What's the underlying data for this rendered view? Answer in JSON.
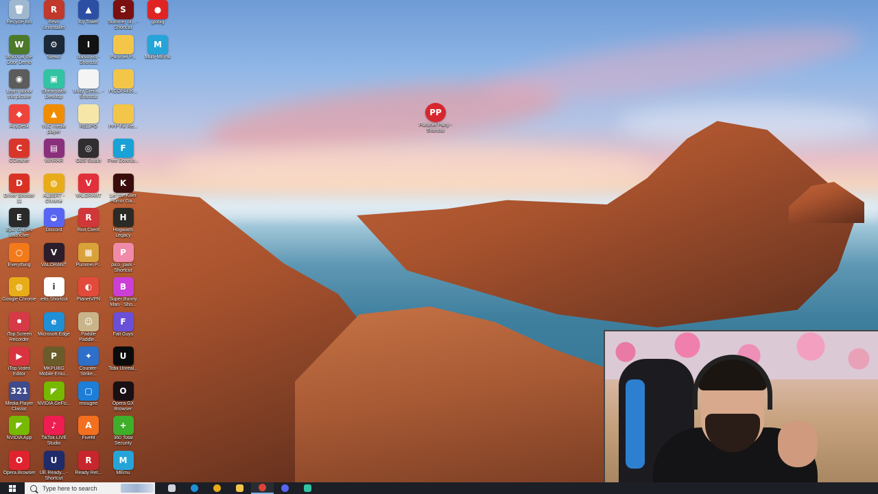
{
  "desktop": {
    "icons": [
      {
        "label": "Recycle Bin",
        "icon": "recycle-bin-icon",
        "color": "#9fb7cf",
        "glyph": "🗑",
        "col": 0,
        "row": 0
      },
      {
        "label": "Revo Uninstaller",
        "icon": "revo-uninstaller-icon",
        "color": "#c0392b",
        "glyph": "R",
        "col": 1,
        "row": 0
      },
      {
        "label": "Icy Tower",
        "icon": "icy-tower-icon",
        "color": "#2c4fa3",
        "glyph": "▲",
        "col": 2,
        "row": 0
      },
      {
        "label": "Summer of... - Shortcut",
        "icon": "summer-game-icon",
        "color": "#7a1010",
        "glyph": "S",
        "col": 3,
        "row": 0
      },
      {
        "label": "globig",
        "icon": "globig-icon",
        "color": "#e02424",
        "glyph": "●",
        "col": 4,
        "row": 0
      },
      {
        "label": "Who's at the Door Demo",
        "icon": "door-demo-icon",
        "color": "#4c7a2a",
        "glyph": "W",
        "col": 0,
        "row": 1
      },
      {
        "label": "Steam",
        "icon": "steam-icon",
        "color": "#1b2838",
        "glyph": "⚙",
        "col": 1,
        "row": 1
      },
      {
        "label": "Illusionist - Shortcut",
        "icon": "illusionist-icon",
        "color": "#121212",
        "glyph": "I",
        "col": 2,
        "row": 1
      },
      {
        "label": "Pummel P...",
        "icon": "folder-icon",
        "color": "#f3c64a",
        "glyph": "",
        "col": 3,
        "row": 1
      },
      {
        "label": "Multi-MEmu",
        "icon": "multi-memu-icon",
        "color": "#25a4d8",
        "glyph": "M",
        "col": 4,
        "row": 1
      },
      {
        "label": "Learn about this picture",
        "icon": "learn-picture-icon",
        "color": "#5c5c5c",
        "glyph": "◉",
        "col": 0,
        "row": 2
      },
      {
        "label": "Streamlabs Desktop",
        "icon": "streamlabs-icon",
        "color": "#31c3a2",
        "glyph": "▣",
        "col": 1,
        "row": 2
      },
      {
        "label": "Unity Grein... - Shortcut",
        "icon": "document-icon",
        "color": "#f4f4f4",
        "glyph": "",
        "col": 2,
        "row": 2
      },
      {
        "label": "PICOPARK...",
        "icon": "folder-icon",
        "color": "#f3c64a",
        "glyph": "",
        "col": 3,
        "row": 2
      },
      {
        "label": "AnyDesk",
        "icon": "anydesk-icon",
        "color": "#ef443b",
        "glyph": "◆",
        "col": 0,
        "row": 3
      },
      {
        "label": "VLC media player",
        "icon": "vlc-icon",
        "color": "#f08c00",
        "glyph": "▲",
        "col": 1,
        "row": 3
      },
      {
        "label": "RELIPO",
        "icon": "document-icon",
        "color": "#f6e7a8",
        "glyph": "",
        "col": 2,
        "row": 3
      },
      {
        "label": "PPP Fix Re...",
        "icon": "folder-icon",
        "color": "#f3c64a",
        "glyph": "",
        "col": 3,
        "row": 3
      },
      {
        "label": "CCleaner",
        "icon": "ccleaner-icon",
        "color": "#d9362b",
        "glyph": "C",
        "col": 0,
        "row": 4
      },
      {
        "label": "WinRAR",
        "icon": "winrar-icon",
        "color": "#8a2f7c",
        "glyph": "▤",
        "col": 1,
        "row": 4
      },
      {
        "label": "OBS Studio",
        "icon": "obs-icon",
        "color": "#302e31",
        "glyph": "◎",
        "col": 2,
        "row": 4
      },
      {
        "label": "Free Downlo...",
        "icon": "free-download-icon",
        "color": "#1aa1d6",
        "glyph": "F",
        "col": 3,
        "row": 4
      },
      {
        "label": "Driver Booster 11",
        "icon": "driver-booster-icon",
        "color": "#d93224",
        "glyph": "D",
        "col": 0,
        "row": 5
      },
      {
        "label": "ALBERT - Chrome",
        "icon": "chrome-icon",
        "color": "#e8ac18",
        "glyph": "◍",
        "col": 1,
        "row": 5
      },
      {
        "label": "VALORANT",
        "icon": "valorant-icon",
        "color": "#e1303b",
        "glyph": "V",
        "col": 2,
        "row": 5
      },
      {
        "label": "Let the Killer Horror Ga...",
        "icon": "killer-horror-icon",
        "color": "#3a0d0d",
        "glyph": "K",
        "col": 3,
        "row": 5
      },
      {
        "label": "Epic Games Launcher",
        "icon": "epic-games-icon",
        "color": "#2a2a2a",
        "glyph": "E",
        "col": 0,
        "row": 6
      },
      {
        "label": "Discord",
        "icon": "discord-icon",
        "color": "#5865f2",
        "glyph": "◒",
        "col": 1,
        "row": 6
      },
      {
        "label": "Riot Client",
        "icon": "riot-client-icon",
        "color": "#d13639",
        "glyph": "R",
        "col": 2,
        "row": 6
      },
      {
        "label": "Hogwarts Legacy",
        "icon": "hogwarts-icon",
        "color": "#2c2a25",
        "glyph": "H",
        "col": 3,
        "row": 6
      },
      {
        "label": "Everything",
        "icon": "everything-search-icon",
        "color": "#f27a1a",
        "glyph": "○",
        "col": 0,
        "row": 7
      },
      {
        "label": "VALORANT",
        "icon": "valorant-icon",
        "color": "#2b1d2b",
        "glyph": "V",
        "col": 1,
        "row": 7
      },
      {
        "label": "Pummel P...",
        "icon": "pummel-party-icon",
        "color": "#d8a13a",
        "glyph": "▦",
        "col": 2,
        "row": 7
      },
      {
        "label": "pico_park - Shortcut",
        "icon": "pico-park-icon",
        "color": "#f08aa8",
        "glyph": "P",
        "col": 3,
        "row": 7
      },
      {
        "label": "Google Chrome",
        "icon": "chrome-icon",
        "color": "#e8ac18",
        "glyph": "◍",
        "col": 0,
        "row": 8
      },
      {
        "label": "ielts Shortcut",
        "icon": "ielts-icon",
        "color": "#ffffff",
        "glyph": "i",
        "col": 1,
        "row": 8
      },
      {
        "label": "PlanetVPN",
        "icon": "planetvpn-icon",
        "color": "#e24a3b",
        "glyph": "◐",
        "col": 2,
        "row": 8
      },
      {
        "label": "Super Bunny Man - Sho...",
        "icon": "super-bunny-icon",
        "color": "#cc3fd6",
        "glyph": "B",
        "col": 3,
        "row": 8
      },
      {
        "label": "iTop Screen Recorder",
        "icon": "itop-recorder-icon",
        "color": "#d63a47",
        "glyph": "⏺",
        "col": 0,
        "row": 9
      },
      {
        "label": "Microsoft Edge",
        "icon": "edge-icon",
        "color": "#1f8fd6",
        "glyph": "e",
        "col": 1,
        "row": 9
      },
      {
        "label": "Paddle Paddle...",
        "icon": "paddle-icon",
        "color": "#c9b48a",
        "glyph": "☺",
        "col": 2,
        "row": 9
      },
      {
        "label": "Fall Guys",
        "icon": "fall-guys-icon",
        "color": "#6a4fd8",
        "glyph": "F",
        "col": 3,
        "row": 9
      },
      {
        "label": "iTop Video Editor",
        "icon": "itop-editor-icon",
        "color": "#d8343f",
        "glyph": "▶",
        "col": 0,
        "row": 10
      },
      {
        "label": "MKPUBG Mobile Emu...",
        "icon": "pubg-emulator-icon",
        "color": "#6a5c2a",
        "glyph": "P",
        "col": 1,
        "row": 10
      },
      {
        "label": "Counter-Strike...",
        "icon": "counter-strike-icon",
        "color": "#2e6fc9",
        "glyph": "✦",
        "col": 2,
        "row": 10
      },
      {
        "label": "Tobii Unreal...",
        "icon": "unreal-icon",
        "color": "#0b0b0b",
        "glyph": "U",
        "col": 3,
        "row": 10
      },
      {
        "label": "Media Player Classic",
        "icon": "mpc-icon",
        "color": "#3f4b8a",
        "glyph": "321",
        "col": 0,
        "row": 11
      },
      {
        "label": "NVIDIA GeFo...",
        "icon": "geforce-icon",
        "color": "#76b900",
        "glyph": "◤",
        "col": 1,
        "row": 11
      },
      {
        "label": "misugee",
        "icon": "misugee-icon",
        "color": "#1d7ed8",
        "glyph": "▢",
        "col": 2,
        "row": 11
      },
      {
        "label": "Opera GX Browser",
        "icon": "opera-gx-icon",
        "color": "#1a0f12",
        "glyph": "O",
        "col": 3,
        "row": 11
      },
      {
        "label": "NVIDIA App",
        "icon": "nvidia-app-icon",
        "color": "#76b900",
        "glyph": "◤",
        "col": 0,
        "row": 12
      },
      {
        "label": "TikTok LIVE Studio",
        "icon": "tiktok-live-icon",
        "color": "#ee1d52",
        "glyph": "♪",
        "col": 1,
        "row": 12
      },
      {
        "label": "FiveM",
        "icon": "fivem-icon",
        "color": "#f37021",
        "glyph": "A",
        "col": 2,
        "row": 12
      },
      {
        "label": "360 Total Security",
        "icon": "total-security-icon",
        "color": "#3fae2a",
        "glyph": "+",
        "col": 3,
        "row": 12
      },
      {
        "label": "Opera Browser",
        "icon": "opera-icon",
        "color": "#e1232f",
        "glyph": "O",
        "col": 0,
        "row": 13
      },
      {
        "label": "UE Ready... - Shortcut",
        "icon": "ue-shortcut-icon",
        "color": "#1f2b6a",
        "glyph": "U",
        "col": 1,
        "row": 13
      },
      {
        "label": "Ready Ret...",
        "icon": "ready-icon",
        "color": "#c8262d",
        "glyph": "R",
        "col": 2,
        "row": 13
      },
      {
        "label": "MEmu",
        "icon": "memu-icon",
        "color": "#25a4d8",
        "glyph": "M",
        "col": 3,
        "row": 13
      }
    ],
    "floating_icon": {
      "label": "Pummel Party - Shortcut",
      "icon": "pummel-party-shortcut-icon",
      "color": "#d8262f",
      "glyph": "PP"
    }
  },
  "taskbar": {
    "search_placeholder": "Type here to search",
    "apps": [
      {
        "name": "task-view",
        "color": "#cfd4dc"
      },
      {
        "name": "edge",
        "color": "#1f8fd6"
      },
      {
        "name": "chrome",
        "color": "#e8ac18"
      },
      {
        "name": "file-explorer",
        "color": "#f3c64a"
      },
      {
        "name": "chrome-alt",
        "color": "#db4437"
      },
      {
        "name": "discord",
        "color": "#5865f2"
      },
      {
        "name": "streamlabs",
        "color": "#31c3a2"
      }
    ]
  }
}
